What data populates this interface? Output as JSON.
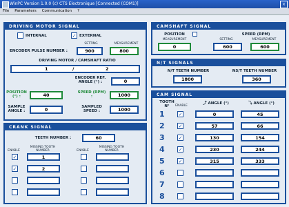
{
  "window": {
    "title": "WinPC Version 1.0.0 (c) CTS Electronique  [Connected (COM1)]",
    "close": "×"
  },
  "menu": [
    "File",
    "Parameters",
    "Communication",
    "?"
  ],
  "driving": {
    "title": "DRIVING MOTOR SIGNAL",
    "internal": "INTERNAL",
    "external": "EXTERNAL",
    "setting": "SETTING",
    "measurement": "MEASUREMENT",
    "encoder_pulse": "ENCODER PULSE NUMBER :",
    "encoder_setting": "900",
    "encoder_measure": "800",
    "ratio_label": "DRIVING MOTOR / CAMSHAFT RATIO",
    "ratio_num": "1",
    "ratio_sep": "/",
    "ratio_den": "2",
    "ref_angle_label": "ENCODER REF. ANGLE (°) :",
    "ref_angle": "0",
    "position_label": "POSITION (°) :",
    "position": "40",
    "speed_label": "SPEED (RPM) :",
    "speed": "1000",
    "sample_angle_label": "SAMPLE ANGLE :",
    "sample_angle": "0",
    "sampled_speed_label": "SAMPLED SPEED :",
    "sampled_speed": "1000"
  },
  "camshaft": {
    "title": "CAMSHAFT SIGNAL",
    "position_label": "POSITION",
    "speed_label": "SPEED (RPM)",
    "measurement": "MEASUREMENT",
    "setting": "SETTING",
    "position": "0",
    "speed_setting": "600",
    "speed_measure": "600"
  },
  "nt": {
    "title": "N/T SIGNALS",
    "n_label": "N/T TEETH NUMBER",
    "nt_label": "NS/T TEETH NUMBER",
    "n_value": "1800",
    "nt_value": "360"
  },
  "crank": {
    "title": "CRANK SIGNAL",
    "teeth_label": "TEETH NUMBER :",
    "teeth": "60",
    "enable": "ENABLE",
    "missing": "MISSING TOOTH NUMBER",
    "left": [
      {
        "checked": true,
        "value": "1"
      },
      {
        "checked": true,
        "value": "2"
      },
      {
        "checked": false,
        "value": ""
      },
      {
        "checked": false,
        "value": ""
      }
    ],
    "right": [
      {
        "checked": false,
        "value": ""
      },
      {
        "checked": false,
        "value": ""
      },
      {
        "checked": false,
        "value": ""
      },
      {
        "checked": false,
        "value": ""
      }
    ]
  },
  "cam": {
    "title": "CAM SIGNAL",
    "tooth_label": "TOOTH N°",
    "enable": "ENABLE",
    "rise_label": "ANGLE (°)",
    "fall_label": "ANGLE (°)",
    "rows": [
      {
        "n": "1",
        "checked": true,
        "rise": "0",
        "fall": "45"
      },
      {
        "n": "2",
        "checked": true,
        "rise": "57",
        "fall": "66"
      },
      {
        "n": "3",
        "checked": true,
        "rise": "130",
        "fall": "154"
      },
      {
        "n": "4",
        "checked": true,
        "rise": "230",
        "fall": "244"
      },
      {
        "n": "5",
        "checked": true,
        "rise": "315",
        "fall": "333"
      },
      {
        "n": "6",
        "checked": false,
        "rise": "",
        "fall": ""
      },
      {
        "n": "7",
        "checked": false,
        "rise": "",
        "fall": ""
      },
      {
        "n": "8",
        "checked": false,
        "rise": "",
        "fall": ""
      }
    ]
  }
}
